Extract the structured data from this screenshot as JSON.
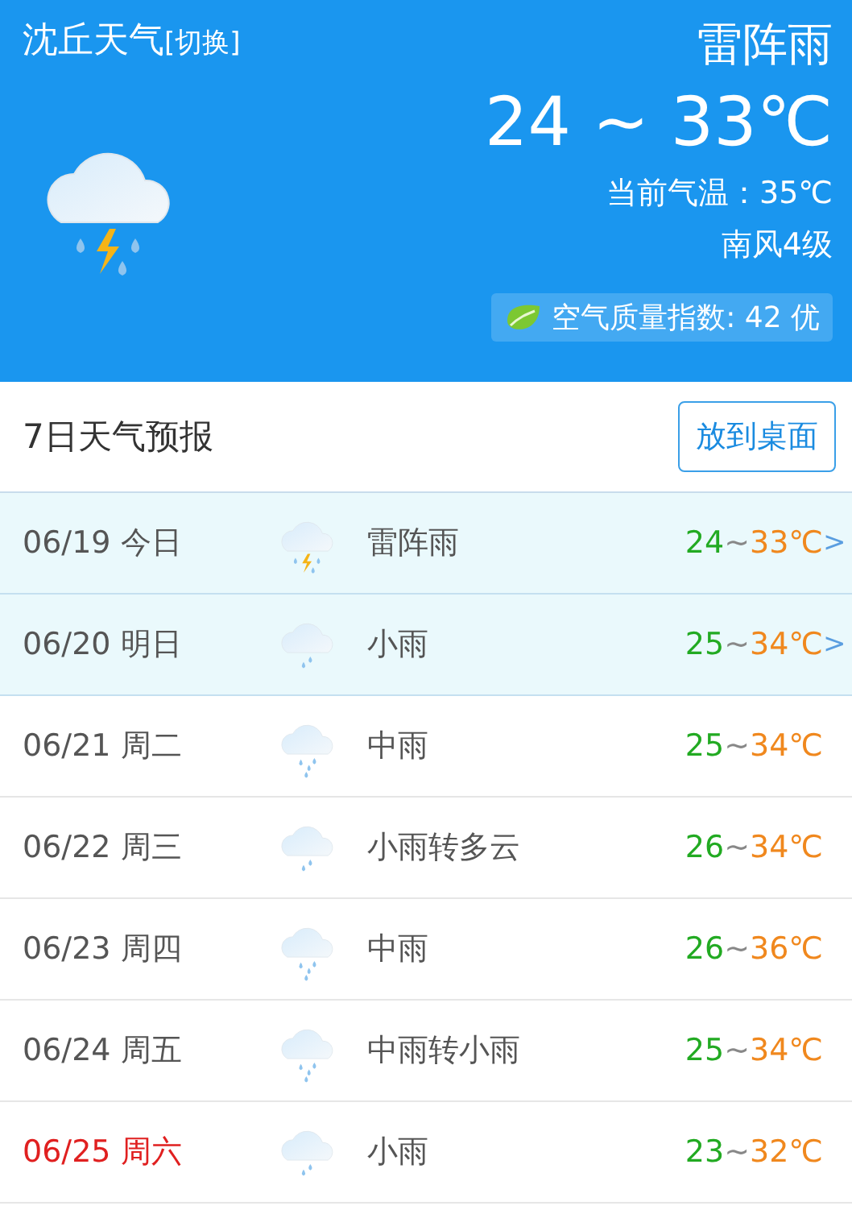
{
  "header": {
    "city": "沈丘天气",
    "switch_link": "[切换]",
    "kind": "thunderstorm",
    "condition": "雷阵雨",
    "temp_range": "24 ~ 33℃",
    "current_temp": "当前气温：35℃",
    "wind": "南风4级",
    "air_quality": "空气质量指数: 42 优"
  },
  "forecast": {
    "title": "7日天气预报",
    "button": "放到桌面",
    "days": [
      {
        "date": "06/19 今日",
        "kind": "thunderstorm",
        "condition": "雷阵雨",
        "low": "24",
        "sep": "~",
        "high": "33℃",
        "highlighted": true,
        "weekend": false,
        "chevron": ">"
      },
      {
        "date": "06/20 明日",
        "kind": "light-rain",
        "condition": "小雨",
        "low": "25",
        "sep": "~",
        "high": "34℃",
        "highlighted": true,
        "weekend": false,
        "chevron": ">"
      },
      {
        "date": "06/21 周二",
        "kind": "moderate-rain",
        "condition": "中雨",
        "low": "25",
        "sep": "~",
        "high": "34℃",
        "highlighted": false,
        "weekend": false
      },
      {
        "date": "06/22 周三",
        "kind": "light-rain",
        "condition": "小雨转多云",
        "low": "26",
        "sep": "~",
        "high": "34℃",
        "highlighted": false,
        "weekend": false
      },
      {
        "date": "06/23 周四",
        "kind": "moderate-rain",
        "condition": "中雨",
        "low": "26",
        "sep": "~",
        "high": "36℃",
        "highlighted": false,
        "weekend": false
      },
      {
        "date": "06/24 周五",
        "kind": "moderate-rain",
        "condition": "中雨转小雨",
        "low": "25",
        "sep": "~",
        "high": "34℃",
        "highlighted": false,
        "weekend": false
      },
      {
        "date": "06/25 周六",
        "kind": "light-rain",
        "condition": "小雨",
        "low": "23",
        "sep": "~",
        "high": "32℃",
        "highlighted": false,
        "weekend": true
      }
    ]
  }
}
